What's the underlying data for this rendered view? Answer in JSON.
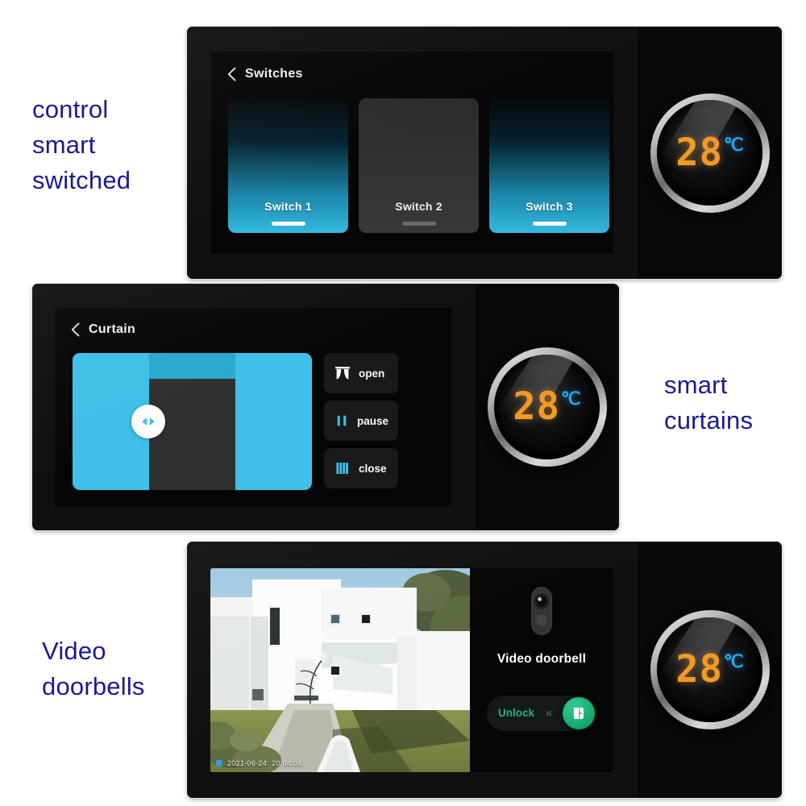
{
  "captions": {
    "switches": "control\nsmart\nswitched",
    "curtains": "smart\ncurtains",
    "doorbell": "Video\ndoorbells"
  },
  "colors": {
    "caption_blue": "#1b1b8f",
    "accent_cyan": "#3ec0e8",
    "switch_on_cyan": "#35b9e0",
    "switch_off_gray": "#333333",
    "temp_orange": "#f09a28",
    "unit_blue": "#29a8ef",
    "unlock_green": "#12a869",
    "device_black": "#0a0a0a"
  },
  "thermostat": {
    "temperature": "28",
    "unit": "℃",
    "name": "thermostat-dial"
  },
  "panels": {
    "switches": {
      "title": "Switches",
      "back_icon": "chevron-left-icon",
      "cards": [
        {
          "label": "Switch 1",
          "state": "on"
        },
        {
          "label": "Switch 2",
          "state": "off"
        },
        {
          "label": "Switch 3",
          "state": "on"
        }
      ]
    },
    "curtain": {
      "title": "Curtain",
      "back_icon": "chevron-left-icon",
      "handle_icon": "left-right-arrows-icon",
      "controls": [
        {
          "label": "open",
          "icon": "curtain-open-icon"
        },
        {
          "label": "pause",
          "icon": "pause-bars-icon"
        },
        {
          "label": "close",
          "icon": "curtain-closed-icon"
        }
      ]
    },
    "doorbell": {
      "title": "Video doorbell",
      "device_icon": "doorbell-camera-icon",
      "video": {
        "timestamp_date": "2021-06-24",
        "timestamp_time": "20:04:04"
      },
      "unlock": {
        "label": "Unlock",
        "chevrons": "«",
        "knob_icon": "open-door-icon"
      }
    }
  }
}
